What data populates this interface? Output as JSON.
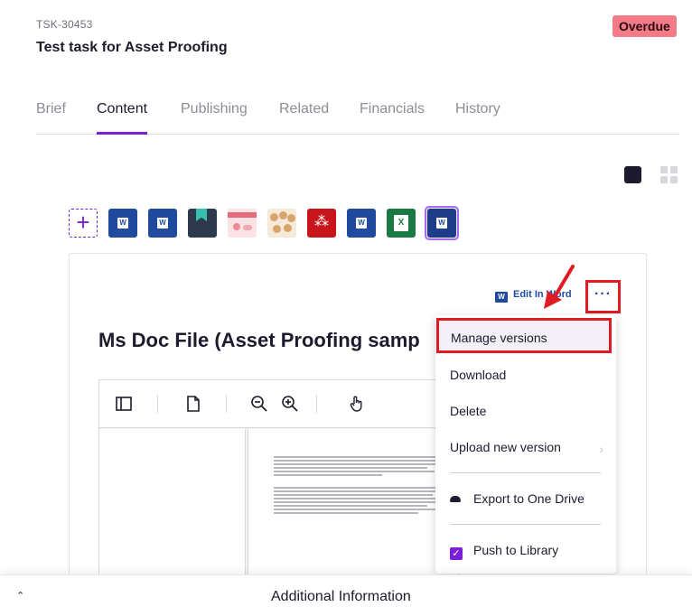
{
  "task": {
    "id": "TSK-30453",
    "title": "Test task for Asset Proofing",
    "status_badge": "Overdue"
  },
  "tabs": [
    {
      "label": "Brief",
      "active": false
    },
    {
      "label": "Content",
      "active": true
    },
    {
      "label": "Publishing",
      "active": false
    },
    {
      "label": "Related",
      "active": false
    },
    {
      "label": "Financials",
      "active": false
    },
    {
      "label": "History",
      "active": false
    }
  ],
  "view_toggle": {
    "icons": [
      "list-view-icon",
      "grid-view-icon"
    ],
    "active": "list-view-icon"
  },
  "asset_thumbnails": [
    {
      "icon": "add-icon"
    },
    {
      "icon": "word-icon"
    },
    {
      "icon": "word-icon"
    },
    {
      "icon": "bookmark-icon"
    },
    {
      "icon": "image-thumbnail"
    },
    {
      "icon": "image-thumbnail"
    },
    {
      "icon": "pdf-icon"
    },
    {
      "icon": "word-icon"
    },
    {
      "icon": "excel-icon"
    },
    {
      "icon": "word-icon",
      "selected": true
    }
  ],
  "asset": {
    "title": "Ms Doc File (Asset Proofing samp",
    "edit_link": "Edit In Word",
    "more_button": "···"
  },
  "menu": {
    "manage_versions": "Manage versions",
    "download": "Download",
    "delete": "Delete",
    "upload_new_version": "Upload new version",
    "export_to_one_drive": "Export to One Drive",
    "push_to_library": "Push to Library"
  },
  "footer": {
    "title": "Additional Information"
  },
  "colors": {
    "accent": "#7a1fd6",
    "badge": "#f37a87",
    "highlight": "#e01b23",
    "word": "#1f4a9e",
    "excel": "#1b7a43",
    "pdf": "#c8151b"
  }
}
